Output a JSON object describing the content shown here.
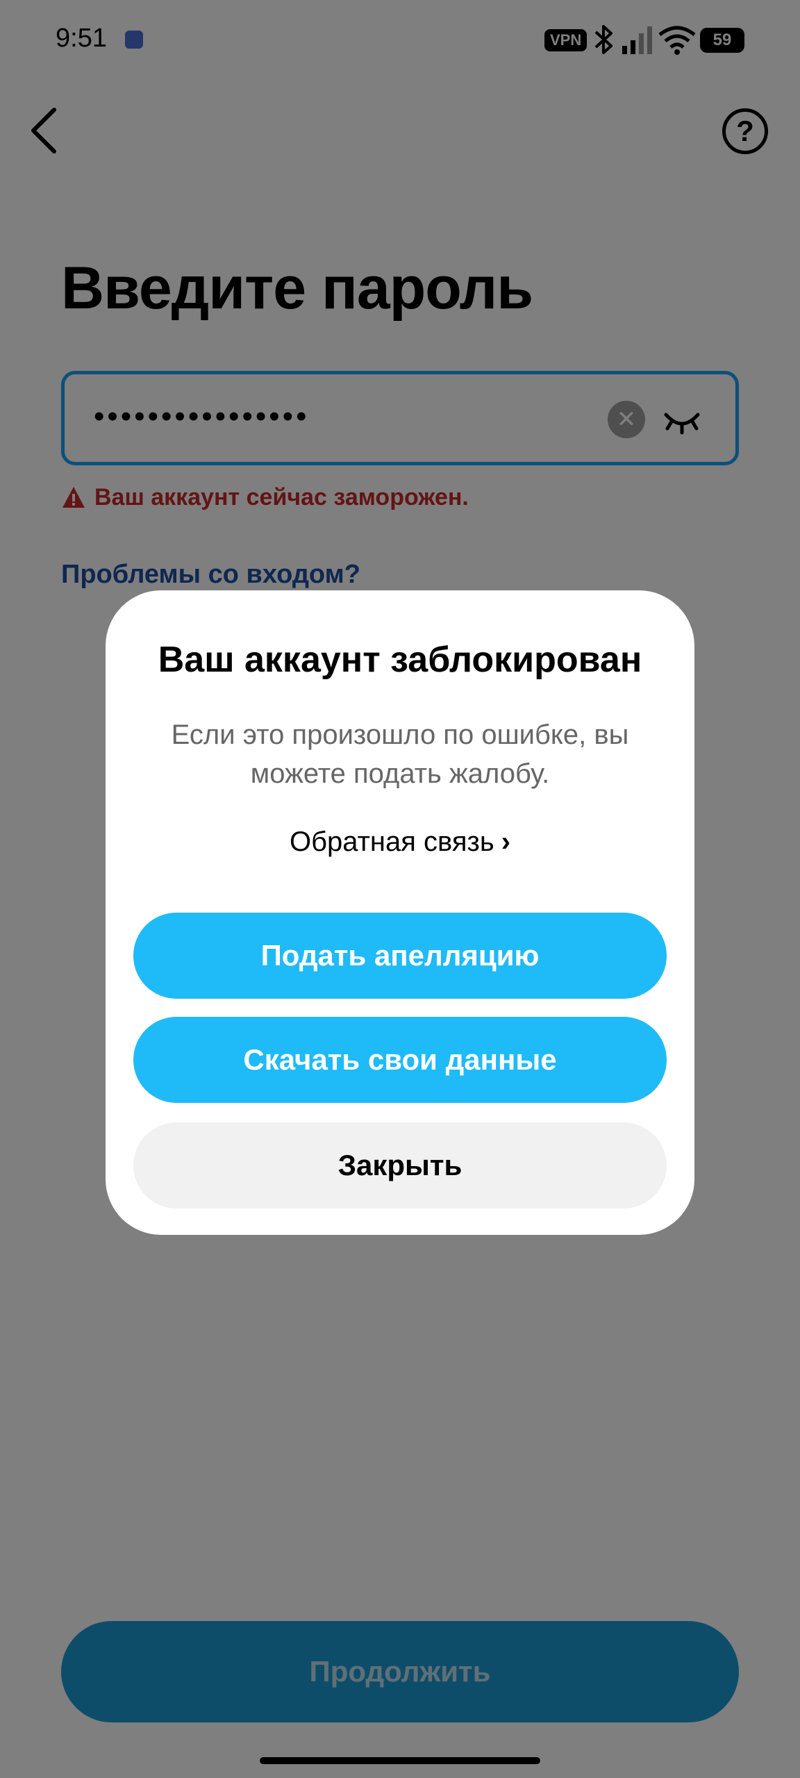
{
  "status_bar": {
    "time": "9:51",
    "vpn_label": "VPN",
    "battery": "59"
  },
  "header": {
    "back_icon": "chevron-left-icon",
    "help_icon": "help-circle-icon",
    "help_glyph": "?"
  },
  "main": {
    "title": "Введите пароль",
    "password_value": "••••••••••••••••",
    "clear_glyph": "✕",
    "error_text": "Ваш аккаунт сейчас заморожен.",
    "trouble_link": "Проблемы со входом?",
    "continue_label": "Продолжить"
  },
  "modal": {
    "title": "Ваш аккаунт заблокирован",
    "body": "Если это произошло по ошибке, вы можете подать жалобу.",
    "feedback_label": "Обратная связь",
    "feedback_chevron": "›",
    "appeal_label": "Подать апелляцию",
    "download_label": "Скачать свои данные",
    "close_label": "Закрыть"
  },
  "colors": {
    "accent": "#1fbaf8",
    "error": "#c62828",
    "link": "#1e4fa0",
    "overlay": "#808080"
  }
}
